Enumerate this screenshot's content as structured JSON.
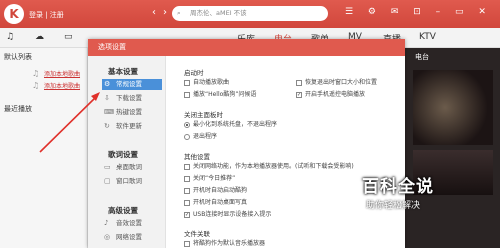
{
  "topbar": {
    "logo": "K",
    "login": "登录 | 注册",
    "search_placeholder": "周杰伦、aMEI 不该",
    "search_icon": "magnifier-icon",
    "colors": {
      "primary": "#d1473c",
      "selected_nav": "#4a90d9"
    }
  },
  "tabs": [
    {
      "label": "乐库"
    },
    {
      "label": "电台"
    },
    {
      "label": "歌单"
    },
    {
      "label": "MV"
    },
    {
      "label": "直播"
    },
    {
      "label": "KTV"
    }
  ],
  "sidebar": {
    "sections": [
      "默认列表",
      "最近播放"
    ],
    "add_link": "添加本地歌曲"
  },
  "right_pane": {
    "label": "电台"
  },
  "dialog": {
    "title": "选项设置",
    "nav_sections": [
      {
        "title": "基本设置",
        "items": [
          {
            "label": "常规设置",
            "icon": "gear-icon"
          },
          {
            "label": "下载设置",
            "icon": "download-icon"
          },
          {
            "label": "热键设置",
            "icon": "keyboard-icon"
          },
          {
            "label": "软件更新",
            "icon": "refresh-icon"
          }
        ]
      },
      {
        "title": "歌词设置",
        "items": [
          {
            "label": "桌面歌词",
            "icon": "monitor-icon"
          },
          {
            "label": "窗口歌词",
            "icon": "window-icon"
          }
        ]
      },
      {
        "title": "高级设置",
        "items": [
          {
            "label": "音效设置",
            "icon": "sound-icon"
          },
          {
            "label": "网络设置",
            "icon": "network-icon"
          }
        ]
      }
    ],
    "groups": [
      {
        "title": "启动时",
        "options": [
          {
            "label": "自动播放歌曲",
            "checked": false
          },
          {
            "label": "恢复退出时窗口大小和位置",
            "checked": false
          },
          {
            "label": "播放“Hello酷狗”问候语",
            "checked": false
          },
          {
            "label": "开启手机遥控电脑播放",
            "checked": true
          }
        ]
      },
      {
        "title": "关闭主面板时",
        "radios": [
          {
            "label": "最小化到系统托盘，不退出程序",
            "selected": true
          },
          {
            "label": "退出程序",
            "selected": false
          }
        ]
      },
      {
        "title": "其他设置",
        "options": [
          {
            "label": "关闭网络功能，作为本地播放器使用。(试听和下载会受影响)",
            "checked": false
          },
          {
            "label": "关闭“今日推荐”",
            "checked": false
          },
          {
            "label": "开机时自动启动酷狗",
            "checked": false
          },
          {
            "label": "开机时自动桌面写真",
            "checked": false
          },
          {
            "label": "USB连接时显示设备接入提示",
            "checked": true
          }
        ]
      },
      {
        "title": "文件关联",
        "options": [
          {
            "label": "将酷狗作为默认音乐播放器",
            "checked": false
          }
        ]
      }
    ]
  },
  "watermark": {
    "title": "百科全说",
    "subtitle": "助你轻松解决"
  }
}
